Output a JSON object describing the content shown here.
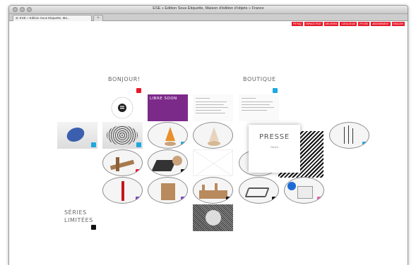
{
  "window": {
    "title": "ESE » Edition Sous Etiquette, Maison d'édition d'objets » France",
    "tab_label": "ESE » Edition Sous Etiquette, Ma...",
    "tab_close": "⊠",
    "new_tab": "+"
  },
  "top_menu": {
    "items": [
      "FR   FAQ",
      "ESPACE ÉTAT",
      "ARCHIVES",
      "CATALOGUE",
      "FR   ESE",
      "ABONNEMENT",
      "ENGLISH"
    ]
  },
  "tiles": {
    "bonjour": "BONJOUR!",
    "boutique": "BOUTIQUE",
    "presse": "PRESSE",
    "presse_sub": "Ouvrir",
    "series": "SÉRIES",
    "limitees": "LIMITÉES",
    "purple_title": "LIBRE SOON"
  },
  "colors": {
    "accent_red": "#e8192c",
    "accent_blue": "#1ea8e0",
    "purple": "#7c2a8a"
  }
}
